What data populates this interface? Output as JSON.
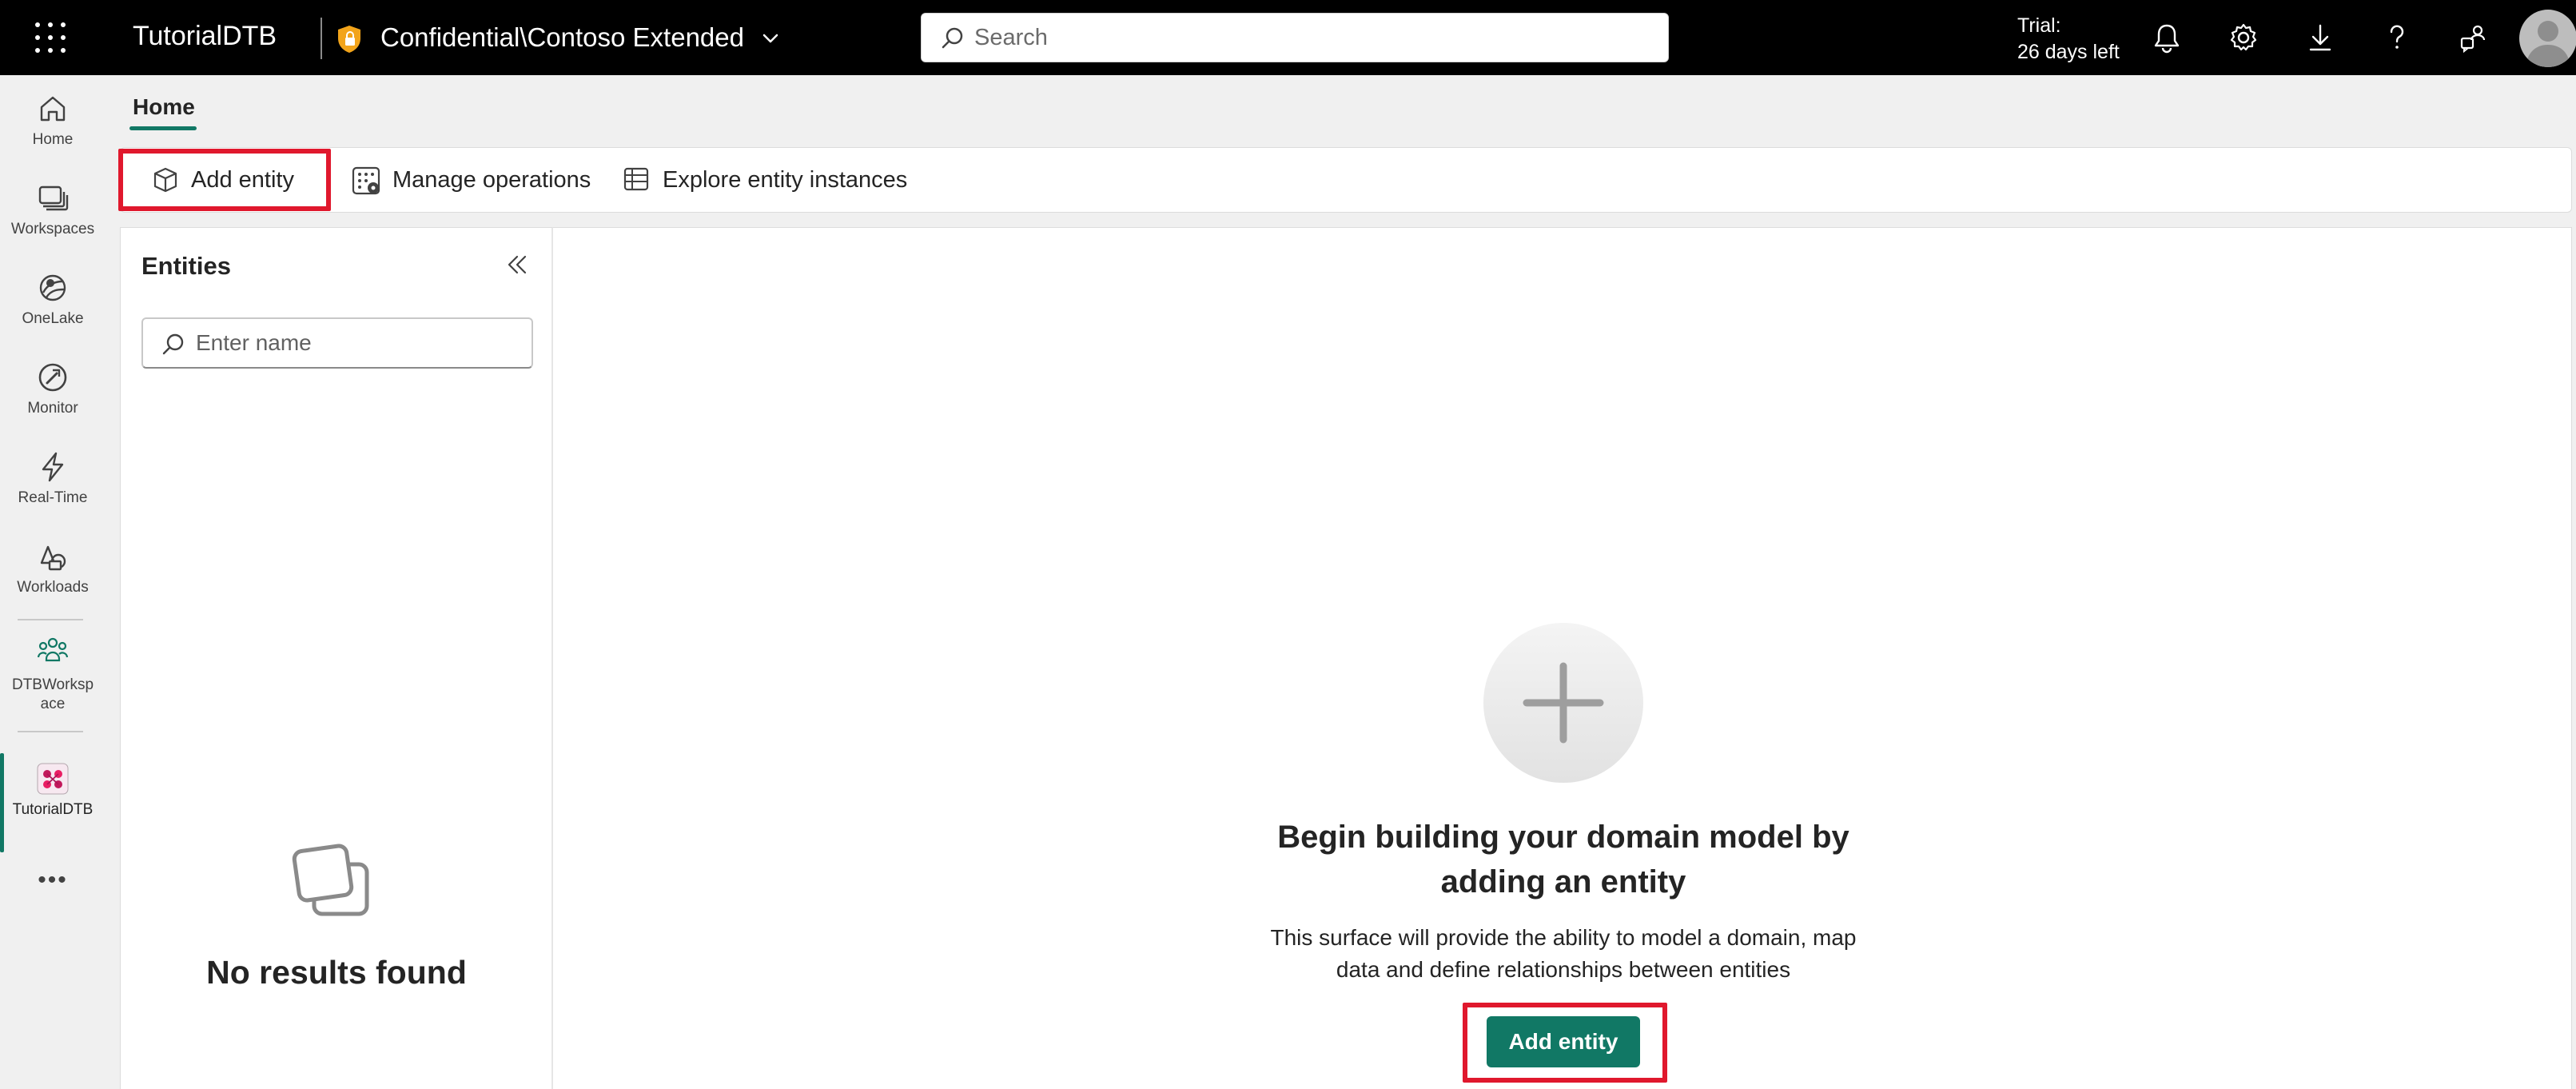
{
  "topbar": {
    "app_name": "TutorialDTB",
    "workspace_label": "Confidential\\Contoso Extended",
    "search_placeholder": "Search",
    "trial_line1": "Trial:",
    "trial_line2": "26 days left",
    "icons": [
      "waffle-icon",
      "shield-lock-icon",
      "chevron-down-icon",
      "search-icon",
      "bell-icon",
      "gear-icon",
      "download-icon",
      "help-icon",
      "share-people-icon",
      "avatar"
    ]
  },
  "rail": {
    "items": [
      {
        "label": "Home",
        "icon": "home-icon"
      },
      {
        "label": "Workspaces",
        "icon": "workspaces-icon"
      },
      {
        "label": "OneLake",
        "icon": "onelake-icon"
      },
      {
        "label": "Monitor",
        "icon": "monitor-icon"
      },
      {
        "label": "Real-Time",
        "icon": "lightning-icon"
      },
      {
        "label": "Workloads",
        "icon": "workloads-icon"
      },
      {
        "label": "DTBWorksp",
        "label2": "ace",
        "icon": "people-group-icon"
      },
      {
        "label": "TutorialDTB",
        "icon": "digital-twin-icon"
      }
    ],
    "more_label": "•••"
  },
  "tabs": {
    "home": "Home"
  },
  "toolbar": {
    "add_entity": "Add entity",
    "manage_operations": "Manage operations",
    "explore_instances": "Explore entity instances"
  },
  "entities_pane": {
    "title": "Entities",
    "filter_placeholder": "Enter name",
    "empty_text": "No results found"
  },
  "main": {
    "heading_line1": "Begin building your domain model by",
    "heading_line2": "adding an entity",
    "desc_line1": "This surface will provide the ability to model a domain, map",
    "desc_line2": "data and define relationships between entities",
    "button_label": "Add entity"
  },
  "colors": {
    "accent": "#117865",
    "highlight": "#e0182d",
    "topbar": "#000000"
  }
}
